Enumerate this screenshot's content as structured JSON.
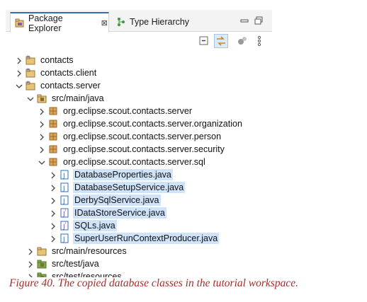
{
  "tabs": {
    "package_explorer": "Package Explorer",
    "close_glyph": "⊠",
    "type_hierarchy": "Type Hierarchy"
  },
  "tree": [
    {
      "label": "contacts",
      "icon": "project-icon",
      "expanded": false,
      "selected": false
    },
    {
      "label": "contacts.client",
      "icon": "project-icon",
      "expanded": false,
      "selected": false
    },
    {
      "label": "contacts.server",
      "icon": "project-icon",
      "expanded": true,
      "selected": false
    },
    {
      "label": "src/main/java",
      "icon": "source-folder-icon",
      "expanded": true,
      "selected": false
    },
    {
      "label": "org.eclipse.scout.contacts.server",
      "icon": "package-icon",
      "expanded": false,
      "selected": false
    },
    {
      "label": "org.eclipse.scout.contacts.server.organization",
      "icon": "package-icon",
      "expanded": false,
      "selected": false
    },
    {
      "label": "org.eclipse.scout.contacts.server.person",
      "icon": "package-icon",
      "expanded": false,
      "selected": false
    },
    {
      "label": "org.eclipse.scout.contacts.server.security",
      "icon": "package-icon",
      "expanded": false,
      "selected": false
    },
    {
      "label": "org.eclipse.scout.contacts.server.sql",
      "icon": "package-icon",
      "expanded": true,
      "selected": false
    },
    {
      "label": "DatabaseProperties.java",
      "icon": "java-file-icon",
      "expanded": false,
      "selected": true
    },
    {
      "label": "DatabaseSetupService.java",
      "icon": "java-file-icon",
      "expanded": false,
      "selected": true
    },
    {
      "label": "DerbySqlService.java",
      "icon": "java-file-icon",
      "expanded": false,
      "selected": true
    },
    {
      "label": "IDataStoreService.java",
      "icon": "java-interface-icon",
      "expanded": false,
      "selected": true
    },
    {
      "label": "SQLs.java",
      "icon": "java-interface-icon",
      "expanded": false,
      "selected": true
    },
    {
      "label": "SuperUserRunContextProducer.java",
      "icon": "java-file-icon",
      "expanded": false,
      "selected": true
    },
    {
      "label": "src/main/resources",
      "icon": "folder-icon",
      "expanded": false,
      "selected": false
    },
    {
      "label": "src/test/java",
      "icon": "test-source-folder-icon",
      "expanded": false,
      "selected": false
    },
    {
      "label": "src/test/resources",
      "icon": "test-source-folder-icon",
      "expanded": false,
      "selected": false
    }
  ],
  "caption": "Figure 40. The copied database classes in the tutorial workspace.",
  "colors": {
    "selection": "#cfe4fa",
    "caption": "#a0302c",
    "package": "#b57a3a",
    "java_file": "#2f6fb8"
  }
}
